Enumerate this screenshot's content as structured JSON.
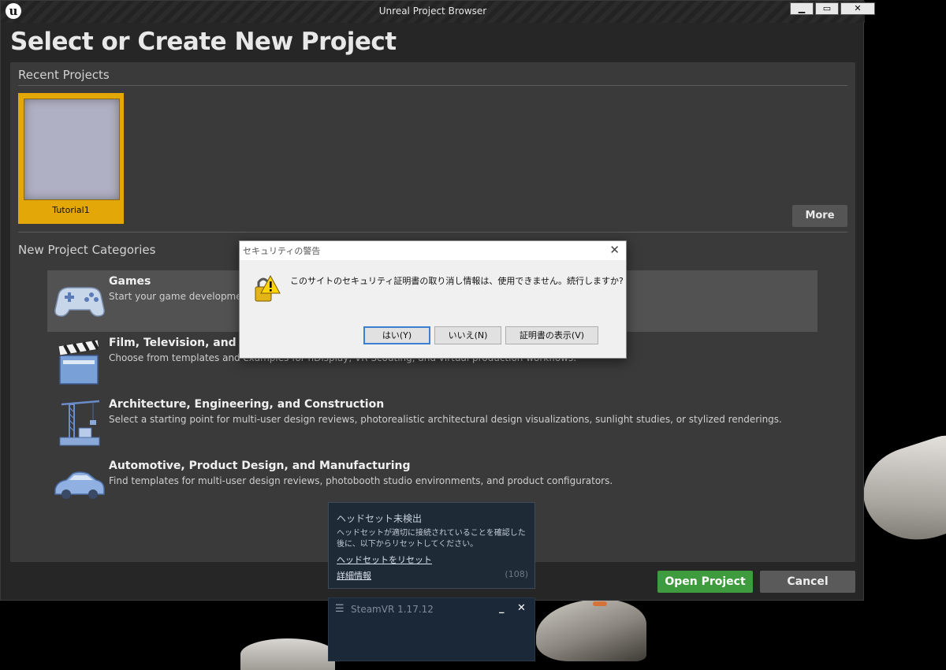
{
  "window": {
    "title": "Unreal Project Browser",
    "logo_letter": "u",
    "min_glyph": "▁",
    "max_glyph": "▭",
    "close_glyph": "✕"
  },
  "header": {
    "title": "Select or Create New Project"
  },
  "recent": {
    "label": "Recent Projects",
    "projects": [
      {
        "name": "Tutorial1"
      }
    ],
    "more_label": "More"
  },
  "categories": {
    "label": "New Project Categories",
    "items": [
      {
        "title": "Games",
        "desc": "Start your game development jo",
        "icon": "gamepad-icon"
      },
      {
        "title": "Film, Television, and Live",
        "desc": "Choose from templates and examples for nDisplay, VR Scouting, and virtual production workflows.",
        "icon": "clapperboard-icon"
      },
      {
        "title": "Architecture, Engineering, and Construction",
        "desc": "Select a starting point for multi-user design reviews, photorealistic architectural design visualizations, sunlight studies, or stylized renderings.",
        "icon": "crane-icon"
      },
      {
        "title": "Automotive, Product Design, and Manufacturing",
        "desc": "Find templates for multi-user design reviews, photobooth studio environments, and product configurators.",
        "icon": "car-icon"
      }
    ]
  },
  "footer": {
    "open_label": "Open Project",
    "cancel_label": "Cancel"
  },
  "dialog": {
    "title": "セキュリティの警告",
    "message": "このサイトのセキュリティ証明書の取り消し情報は、使用できません。続行しますか?",
    "yes": "はい(Y)",
    "no": "いいえ(N)",
    "view_cert": "証明書の表示(V)",
    "close_glyph": "✕"
  },
  "steam_notify": {
    "title": "ヘッドセット未検出",
    "body": "ヘッドセットが適切に接続されていることを確認した後に、以下からリセットしてください。",
    "reset_link": "ヘッドセットをリセット",
    "details_link": "詳細情報",
    "count": "(108)"
  },
  "steamvr": {
    "menu_glyph": "☰",
    "title": "SteamVR 1.17.12",
    "minimize_glyph": "_",
    "close_glyph": "✕"
  },
  "colors": {
    "accent_open": "#3e9b3e",
    "tile_highlight": "#e3a708",
    "panel": "#3a3a3a"
  }
}
